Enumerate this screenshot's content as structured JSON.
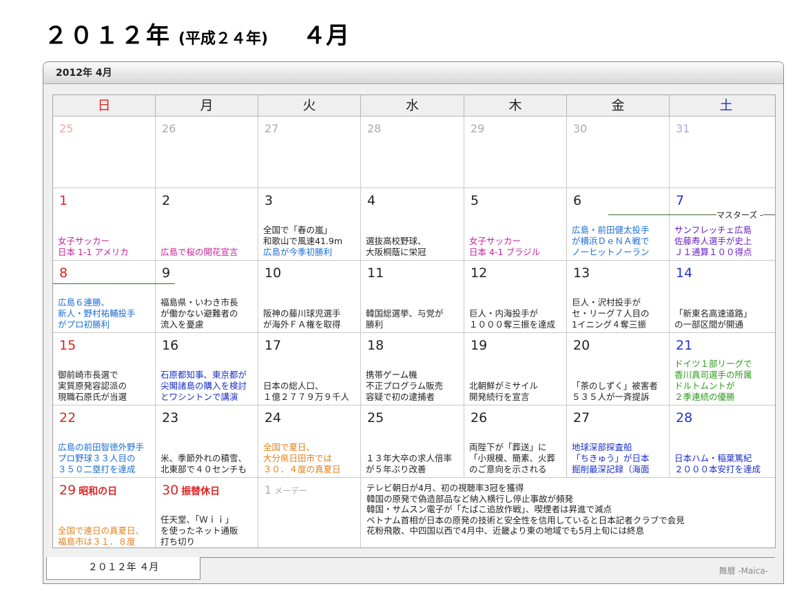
{
  "heading": {
    "main": "２０１２年",
    "era": "(平成２４年)",
    "month": "４月"
  },
  "window": {
    "title": "2012年 4月"
  },
  "weekdays": [
    {
      "label": "日",
      "color": "#dd2222"
    },
    {
      "label": "月",
      "color": "#222222"
    },
    {
      "label": "火",
      "color": "#222222"
    },
    {
      "label": "水",
      "color": "#222222"
    },
    {
      "label": "木",
      "color": "#222222"
    },
    {
      "label": "金",
      "color": "#222222"
    },
    {
      "label": "土",
      "color": "#2233cc"
    }
  ],
  "weeks": [
    [
      {
        "day": "25",
        "other": true
      },
      {
        "day": "26",
        "other": true
      },
      {
        "day": "27",
        "other": true
      },
      {
        "day": "28",
        "other": true
      },
      {
        "day": "29",
        "other": true
      },
      {
        "day": "30",
        "other": true
      },
      {
        "day": "31",
        "other": true
      }
    ],
    [
      {
        "day": "1",
        "events": [
          {
            "text": "女子サッカー",
            "color": "magenta"
          },
          {
            "text": "日本 1-1 アメリカ",
            "color": "magenta"
          }
        ]
      },
      {
        "day": "2",
        "events": [
          {
            "text": "広島で桜の開花宣言",
            "color": "magenta"
          }
        ]
      },
      {
        "day": "3",
        "events": [
          {
            "text": "全国で「春の嵐」",
            "color": "black"
          },
          {
            "text": "和歌山で風速41.9m",
            "color": "black"
          },
          {
            "text": "広島が今季初勝利",
            "color": "blue"
          }
        ]
      },
      {
        "day": "4",
        "events": [
          {
            "text": "選抜高校野球、",
            "color": "black"
          },
          {
            "text": "大阪桐蔭に栄冠",
            "color": "black"
          }
        ]
      },
      {
        "day": "5",
        "events": [
          {
            "text": "女子サッカー",
            "color": "magenta"
          },
          {
            "text": "日本 4-1 ブラジル",
            "color": "magenta"
          }
        ]
      },
      {
        "day": "6",
        "events": [
          {
            "text": "広島・前田健太投手",
            "color": "blue"
          },
          {
            "text": "が横浜ＤｅＮＡ戦で",
            "color": "blue"
          },
          {
            "text": "ノーヒットノーラン",
            "color": "blue"
          }
        ]
      },
      {
        "day": "7",
        "events": [
          {
            "text": "サンフレッチェ広島",
            "color": "purple"
          },
          {
            "text": "佐藤寿人選手が史上",
            "color": "purple"
          },
          {
            "text": "Ｊ１通算１００得点",
            "color": "purple"
          }
        ]
      }
    ],
    [
      {
        "day": "8",
        "events": [
          {
            "text": "広島６連勝、",
            "color": "blue"
          },
          {
            "text": "新人・野村祐輔投手",
            "color": "blue"
          },
          {
            "text": "がプロ初勝利",
            "color": "blue"
          }
        ]
      },
      {
        "day": "9",
        "events": [
          {
            "text": "福島県・いわき市長",
            "color": "black"
          },
          {
            "text": "が働かない避難者の",
            "color": "black"
          },
          {
            "text": "流入を憂慮",
            "color": "black"
          }
        ]
      },
      {
        "day": "10",
        "events": [
          {
            "text": "阪神の藤川球児選手",
            "color": "black"
          },
          {
            "text": "が海外ＦＡ権を取得",
            "color": "black"
          }
        ]
      },
      {
        "day": "11",
        "events": [
          {
            "text": "韓国総選挙、与党が",
            "color": "black"
          },
          {
            "text": "勝利",
            "color": "black"
          }
        ]
      },
      {
        "day": "12",
        "events": [
          {
            "text": "巨人・内海投手が",
            "color": "black"
          },
          {
            "text": "１０００奪三振を達成",
            "color": "black"
          }
        ]
      },
      {
        "day": "13",
        "events": [
          {
            "text": "巨人・沢村投手が",
            "color": "black"
          },
          {
            "text": "セ・リーグ７人目の",
            "color": "black"
          },
          {
            "text": "1イニング４奪三振",
            "color": "black"
          }
        ]
      },
      {
        "day": "14",
        "events": [
          {
            "text": "「新東名高速道路」",
            "color": "black"
          },
          {
            "text": "の一部区間が開通",
            "color": "black"
          }
        ]
      }
    ],
    [
      {
        "day": "15",
        "events": [
          {
            "text": "御前崎市長選で",
            "color": "black"
          },
          {
            "text": "実質原発容認派の",
            "color": "black"
          },
          {
            "text": "現職石原氏が当選",
            "color": "black"
          }
        ]
      },
      {
        "day": "16",
        "events": [
          {
            "text": "石原都知事、東京都が",
            "color": "darkblue"
          },
          {
            "text": "尖閣諸島の購入を検討",
            "color": "darkblue"
          },
          {
            "text": "とワシントンで講演",
            "color": "darkblue"
          }
        ]
      },
      {
        "day": "17",
        "events": [
          {
            "text": "日本の総人口、",
            "color": "black"
          },
          {
            "text": "１億２７７９万９千人",
            "color": "black"
          }
        ]
      },
      {
        "day": "18",
        "events": [
          {
            "text": "携帯ゲーム機",
            "color": "black"
          },
          {
            "text": "不正プログラム販売",
            "color": "black"
          },
          {
            "text": "容疑で初の逮捕者",
            "color": "black"
          }
        ]
      },
      {
        "day": "19",
        "events": [
          {
            "text": "北朝鮮がミサイル",
            "color": "black"
          },
          {
            "text": "開発続行を宣言",
            "color": "black"
          }
        ]
      },
      {
        "day": "20",
        "events": [
          {
            "text": "「茶のしずく」被害者",
            "color": "black"
          },
          {
            "text": "５３５人が一斉提訴",
            "color": "black"
          }
        ]
      },
      {
        "day": "21",
        "events": [
          {
            "text": "ドイツ１部リーグで",
            "color": "green"
          },
          {
            "text": "香川真司選手の所属",
            "color": "green"
          },
          {
            "text": "ドルトムントが",
            "color": "green"
          },
          {
            "text": "２季連続の優勝",
            "color": "green"
          }
        ]
      }
    ],
    [
      {
        "day": "22",
        "events": [
          {
            "text": "広島の前田智徳外野手",
            "color": "blue"
          },
          {
            "text": "プロ野球３３人目の",
            "color": "blue"
          },
          {
            "text": "３５０二塁打を達成",
            "color": "blue"
          }
        ]
      },
      {
        "day": "23",
        "events": [
          {
            "text": "米、季節外れの積雪、",
            "color": "black"
          },
          {
            "text": "北東部で４０センチも",
            "color": "black"
          }
        ]
      },
      {
        "day": "24",
        "events": [
          {
            "text": "全国で夏日、",
            "color": "orange"
          },
          {
            "text": "大分県日田市では",
            "color": "orange"
          },
          {
            "text": "３０．４度の真夏日",
            "color": "orange"
          }
        ]
      },
      {
        "day": "25",
        "events": [
          {
            "text": "１３年大卒の求人倍率",
            "color": "black"
          },
          {
            "text": "が５年ぶり改善",
            "color": "black"
          }
        ]
      },
      {
        "day": "26",
        "events": [
          {
            "text": "両陛下が「葬送」に",
            "color": "black"
          },
          {
            "text": "「小規模、簡素、火葬",
            "color": "black"
          },
          {
            "text": "のご意向を示される",
            "color": "black"
          }
        ]
      },
      {
        "day": "27",
        "events": [
          {
            "text": "地球深部探査船",
            "color": "darkblue"
          },
          {
            "text": "「ちきゅう」が日本",
            "color": "darkblue"
          },
          {
            "text": "掘削最深記録（海面",
            "color": "darkblue"
          }
        ]
      },
      {
        "day": "28",
        "events": [
          {
            "text": "日本ハム・稲葉篤紀",
            "color": "darkblue"
          },
          {
            "text": "２０００本安打を達成",
            "color": "darkblue"
          }
        ]
      }
    ],
    [
      {
        "day": "29",
        "holiday": "昭和の日",
        "sunday_style": true,
        "events": [
          {
            "text": "全国で連日の真夏日、",
            "color": "orange"
          },
          {
            "text": "福島市は３１．８度",
            "color": "orange"
          }
        ]
      },
      {
        "day": "30",
        "holiday": "振替休日",
        "sunday_style": true,
        "events": [
          {
            "text": "任天堂、「Ｗｉｉ」",
            "color": "black"
          },
          {
            "text": "を使ったネット通販",
            "color": "black"
          },
          {
            "text": "打ち切り",
            "color": "black"
          }
        ]
      },
      {
        "day": "1",
        "holiday": "メーデー",
        "other": true,
        "events": []
      }
    ]
  ],
  "month_news": [
    "テレビ朝日が4月、初の視聴率3冠を獲得",
    "韓国の原発で偽造部品など納入横行し停止事故が頻発",
    "韓国・サムスン電子が「たばこ追放作戦」、喫煙者は昇進で減点",
    "ベトナム首相が日本の原発の技術と安全性を信用していると日本記者クラブで会見",
    "花粉飛散、中四国以西で4月中、近畿より東の地域でも5月上旬には終息"
  ],
  "bars": [
    {
      "label": "マスターズ -"
    }
  ],
  "tab": {
    "label": "２０１２年 ４月"
  },
  "brand": "舞暦 -Maica-",
  "colors": {
    "sunday": "#dd2222",
    "saturday": "#2233cc",
    "magenta": "#c81e9c",
    "blue": "#1a6dd4",
    "darkblue": "#1a2ec8",
    "purple": "#6a1ec0",
    "green": "#2b9a1a",
    "orange": "#e3801a"
  }
}
